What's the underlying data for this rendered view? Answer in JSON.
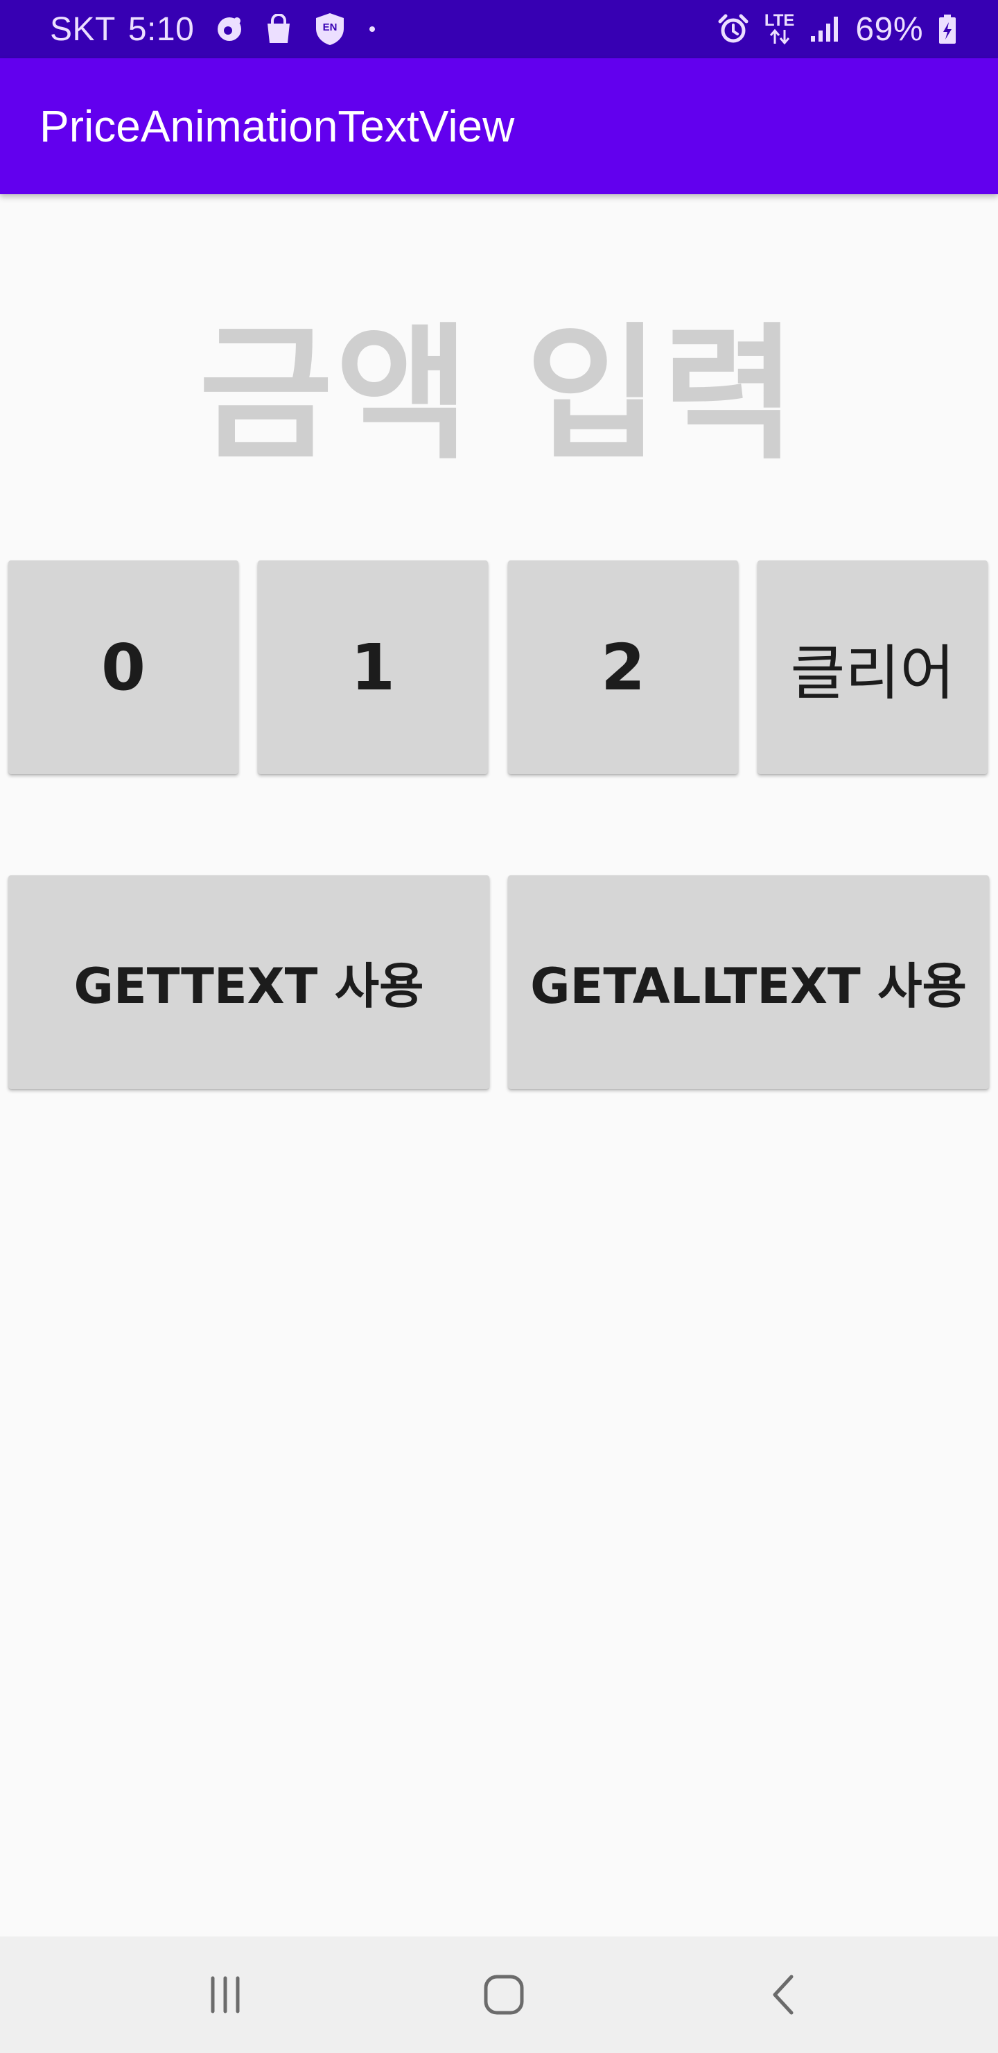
{
  "status_bar": {
    "carrier": "SKT",
    "time": "5:10",
    "network": "LTE",
    "battery": "69%",
    "icons": [
      "camera-dot-icon",
      "shopping-bag-icon",
      "vpn-shield-icon",
      "dot-icon",
      "alarm-icon",
      "data-arrows-icon",
      "signal-icon",
      "battery-charging-icon"
    ],
    "vpn_badge": "EN"
  },
  "app_bar": {
    "title": "PriceAnimationTextView",
    "color": "#6200ee"
  },
  "amount": {
    "placeholder": "금액 입력"
  },
  "keypad": {
    "buttons": [
      {
        "label": "0"
      },
      {
        "label": "1"
      },
      {
        "label": "2"
      },
      {
        "label": "클리어"
      }
    ]
  },
  "actions": {
    "buttons": [
      {
        "label": "GETTEXT 사용"
      },
      {
        "label": "GETALLTEXT 사용"
      }
    ]
  },
  "nav_bar": {
    "items": [
      "recent-apps-icon",
      "home-icon",
      "back-icon"
    ]
  }
}
